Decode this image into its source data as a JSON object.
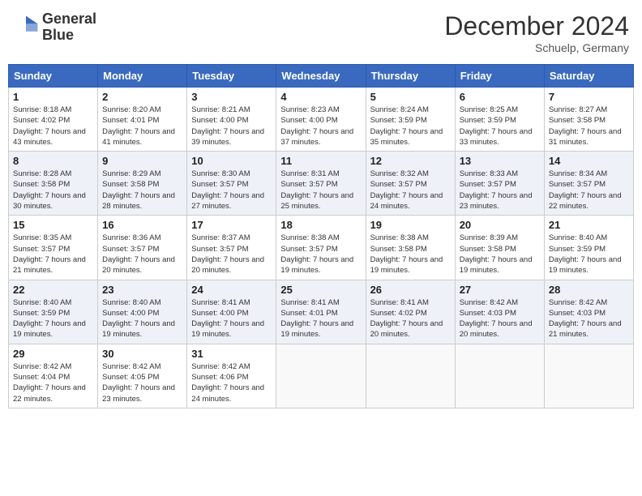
{
  "header": {
    "logo_line1": "General",
    "logo_line2": "Blue",
    "month": "December 2024",
    "location": "Schuelp, Germany"
  },
  "days_of_week": [
    "Sunday",
    "Monday",
    "Tuesday",
    "Wednesday",
    "Thursday",
    "Friday",
    "Saturday"
  ],
  "weeks": [
    [
      {
        "day": 1,
        "info": "Sunrise: 8:18 AM\nSunset: 4:02 PM\nDaylight: 7 hours and 43 minutes."
      },
      {
        "day": 2,
        "info": "Sunrise: 8:20 AM\nSunset: 4:01 PM\nDaylight: 7 hours and 41 minutes."
      },
      {
        "day": 3,
        "info": "Sunrise: 8:21 AM\nSunset: 4:00 PM\nDaylight: 7 hours and 39 minutes."
      },
      {
        "day": 4,
        "info": "Sunrise: 8:23 AM\nSunset: 4:00 PM\nDaylight: 7 hours and 37 minutes."
      },
      {
        "day": 5,
        "info": "Sunrise: 8:24 AM\nSunset: 3:59 PM\nDaylight: 7 hours and 35 minutes."
      },
      {
        "day": 6,
        "info": "Sunrise: 8:25 AM\nSunset: 3:59 PM\nDaylight: 7 hours and 33 minutes."
      },
      {
        "day": 7,
        "info": "Sunrise: 8:27 AM\nSunset: 3:58 PM\nDaylight: 7 hours and 31 minutes."
      }
    ],
    [
      {
        "day": 8,
        "info": "Sunrise: 8:28 AM\nSunset: 3:58 PM\nDaylight: 7 hours and 30 minutes."
      },
      {
        "day": 9,
        "info": "Sunrise: 8:29 AM\nSunset: 3:58 PM\nDaylight: 7 hours and 28 minutes."
      },
      {
        "day": 10,
        "info": "Sunrise: 8:30 AM\nSunset: 3:57 PM\nDaylight: 7 hours and 27 minutes."
      },
      {
        "day": 11,
        "info": "Sunrise: 8:31 AM\nSunset: 3:57 PM\nDaylight: 7 hours and 25 minutes."
      },
      {
        "day": 12,
        "info": "Sunrise: 8:32 AM\nSunset: 3:57 PM\nDaylight: 7 hours and 24 minutes."
      },
      {
        "day": 13,
        "info": "Sunrise: 8:33 AM\nSunset: 3:57 PM\nDaylight: 7 hours and 23 minutes."
      },
      {
        "day": 14,
        "info": "Sunrise: 8:34 AM\nSunset: 3:57 PM\nDaylight: 7 hours and 22 minutes."
      }
    ],
    [
      {
        "day": 15,
        "info": "Sunrise: 8:35 AM\nSunset: 3:57 PM\nDaylight: 7 hours and 21 minutes."
      },
      {
        "day": 16,
        "info": "Sunrise: 8:36 AM\nSunset: 3:57 PM\nDaylight: 7 hours and 20 minutes."
      },
      {
        "day": 17,
        "info": "Sunrise: 8:37 AM\nSunset: 3:57 PM\nDaylight: 7 hours and 20 minutes."
      },
      {
        "day": 18,
        "info": "Sunrise: 8:38 AM\nSunset: 3:57 PM\nDaylight: 7 hours and 19 minutes."
      },
      {
        "day": 19,
        "info": "Sunrise: 8:38 AM\nSunset: 3:58 PM\nDaylight: 7 hours and 19 minutes."
      },
      {
        "day": 20,
        "info": "Sunrise: 8:39 AM\nSunset: 3:58 PM\nDaylight: 7 hours and 19 minutes."
      },
      {
        "day": 21,
        "info": "Sunrise: 8:40 AM\nSunset: 3:59 PM\nDaylight: 7 hours and 19 minutes."
      }
    ],
    [
      {
        "day": 22,
        "info": "Sunrise: 8:40 AM\nSunset: 3:59 PM\nDaylight: 7 hours and 19 minutes."
      },
      {
        "day": 23,
        "info": "Sunrise: 8:40 AM\nSunset: 4:00 PM\nDaylight: 7 hours and 19 minutes."
      },
      {
        "day": 24,
        "info": "Sunrise: 8:41 AM\nSunset: 4:00 PM\nDaylight: 7 hours and 19 minutes."
      },
      {
        "day": 25,
        "info": "Sunrise: 8:41 AM\nSunset: 4:01 PM\nDaylight: 7 hours and 19 minutes."
      },
      {
        "day": 26,
        "info": "Sunrise: 8:41 AM\nSunset: 4:02 PM\nDaylight: 7 hours and 20 minutes."
      },
      {
        "day": 27,
        "info": "Sunrise: 8:42 AM\nSunset: 4:03 PM\nDaylight: 7 hours and 20 minutes."
      },
      {
        "day": 28,
        "info": "Sunrise: 8:42 AM\nSunset: 4:03 PM\nDaylight: 7 hours and 21 minutes."
      }
    ],
    [
      {
        "day": 29,
        "info": "Sunrise: 8:42 AM\nSunset: 4:04 PM\nDaylight: 7 hours and 22 minutes."
      },
      {
        "day": 30,
        "info": "Sunrise: 8:42 AM\nSunset: 4:05 PM\nDaylight: 7 hours and 23 minutes."
      },
      {
        "day": 31,
        "info": "Sunrise: 8:42 AM\nSunset: 4:06 PM\nDaylight: 7 hours and 24 minutes."
      },
      null,
      null,
      null,
      null
    ]
  ]
}
